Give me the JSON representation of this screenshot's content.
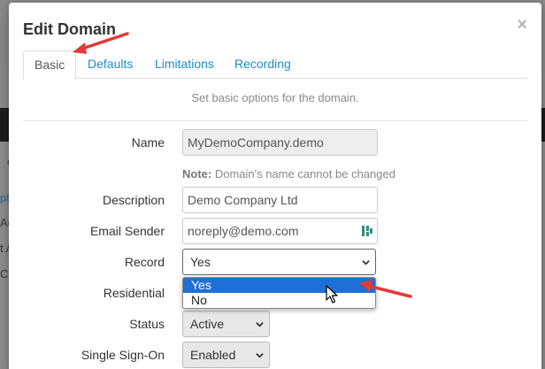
{
  "background": {
    "letters": [
      "C",
      "pt",
      "Ac",
      "t A",
      "Co"
    ]
  },
  "modal": {
    "title": "Edit Domain",
    "close": "×",
    "tabs": [
      {
        "label": "Basic",
        "active": true
      },
      {
        "label": "Defaults",
        "active": false
      },
      {
        "label": "Limitations",
        "active": false
      },
      {
        "label": "Recording",
        "active": false
      }
    ],
    "subtitle": "Set basic options for the domain.",
    "form": {
      "name": {
        "label": "Name",
        "value": "MyDemoCompany.demo"
      },
      "note": {
        "bold": "Note:",
        "text": " Domain's name cannot be changed"
      },
      "description": {
        "label": "Description",
        "value": "Demo Company Ltd"
      },
      "email_sender": {
        "label": "Email Sender",
        "value": "noreply@demo.com"
      },
      "record": {
        "label": "Record",
        "value": "Yes",
        "options": [
          "Yes",
          "No"
        ],
        "highlighted": "Yes"
      },
      "residential": {
        "label": "Residential"
      },
      "status": {
        "label": "Status",
        "value": "Active"
      },
      "sso": {
        "label": "Single Sign-On",
        "value": "Enabled"
      }
    }
  },
  "colors": {
    "link": "#1a8fc4",
    "annotation": "#e53935",
    "highlight": "#1f6fd6"
  }
}
